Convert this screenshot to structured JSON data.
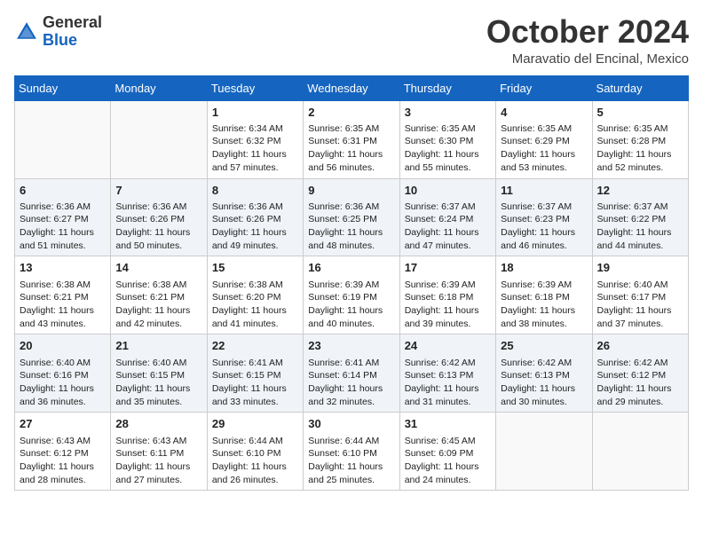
{
  "header": {
    "logo_general": "General",
    "logo_blue": "Blue",
    "month": "October 2024",
    "location": "Maravatio del Encinal, Mexico"
  },
  "weekdays": [
    "Sunday",
    "Monday",
    "Tuesday",
    "Wednesday",
    "Thursday",
    "Friday",
    "Saturday"
  ],
  "weeks": [
    [
      {
        "day": "",
        "info": ""
      },
      {
        "day": "",
        "info": ""
      },
      {
        "day": "1",
        "info": "Sunrise: 6:34 AM\nSunset: 6:32 PM\nDaylight: 11 hours and 57 minutes."
      },
      {
        "day": "2",
        "info": "Sunrise: 6:35 AM\nSunset: 6:31 PM\nDaylight: 11 hours and 56 minutes."
      },
      {
        "day": "3",
        "info": "Sunrise: 6:35 AM\nSunset: 6:30 PM\nDaylight: 11 hours and 55 minutes."
      },
      {
        "day": "4",
        "info": "Sunrise: 6:35 AM\nSunset: 6:29 PM\nDaylight: 11 hours and 53 minutes."
      },
      {
        "day": "5",
        "info": "Sunrise: 6:35 AM\nSunset: 6:28 PM\nDaylight: 11 hours and 52 minutes."
      }
    ],
    [
      {
        "day": "6",
        "info": "Sunrise: 6:36 AM\nSunset: 6:27 PM\nDaylight: 11 hours and 51 minutes."
      },
      {
        "day": "7",
        "info": "Sunrise: 6:36 AM\nSunset: 6:26 PM\nDaylight: 11 hours and 50 minutes."
      },
      {
        "day": "8",
        "info": "Sunrise: 6:36 AM\nSunset: 6:26 PM\nDaylight: 11 hours and 49 minutes."
      },
      {
        "day": "9",
        "info": "Sunrise: 6:36 AM\nSunset: 6:25 PM\nDaylight: 11 hours and 48 minutes."
      },
      {
        "day": "10",
        "info": "Sunrise: 6:37 AM\nSunset: 6:24 PM\nDaylight: 11 hours and 47 minutes."
      },
      {
        "day": "11",
        "info": "Sunrise: 6:37 AM\nSunset: 6:23 PM\nDaylight: 11 hours and 46 minutes."
      },
      {
        "day": "12",
        "info": "Sunrise: 6:37 AM\nSunset: 6:22 PM\nDaylight: 11 hours and 44 minutes."
      }
    ],
    [
      {
        "day": "13",
        "info": "Sunrise: 6:38 AM\nSunset: 6:21 PM\nDaylight: 11 hours and 43 minutes."
      },
      {
        "day": "14",
        "info": "Sunrise: 6:38 AM\nSunset: 6:21 PM\nDaylight: 11 hours and 42 minutes."
      },
      {
        "day": "15",
        "info": "Sunrise: 6:38 AM\nSunset: 6:20 PM\nDaylight: 11 hours and 41 minutes."
      },
      {
        "day": "16",
        "info": "Sunrise: 6:39 AM\nSunset: 6:19 PM\nDaylight: 11 hours and 40 minutes."
      },
      {
        "day": "17",
        "info": "Sunrise: 6:39 AM\nSunset: 6:18 PM\nDaylight: 11 hours and 39 minutes."
      },
      {
        "day": "18",
        "info": "Sunrise: 6:39 AM\nSunset: 6:18 PM\nDaylight: 11 hours and 38 minutes."
      },
      {
        "day": "19",
        "info": "Sunrise: 6:40 AM\nSunset: 6:17 PM\nDaylight: 11 hours and 37 minutes."
      }
    ],
    [
      {
        "day": "20",
        "info": "Sunrise: 6:40 AM\nSunset: 6:16 PM\nDaylight: 11 hours and 36 minutes."
      },
      {
        "day": "21",
        "info": "Sunrise: 6:40 AM\nSunset: 6:15 PM\nDaylight: 11 hours and 35 minutes."
      },
      {
        "day": "22",
        "info": "Sunrise: 6:41 AM\nSunset: 6:15 PM\nDaylight: 11 hours and 33 minutes."
      },
      {
        "day": "23",
        "info": "Sunrise: 6:41 AM\nSunset: 6:14 PM\nDaylight: 11 hours and 32 minutes."
      },
      {
        "day": "24",
        "info": "Sunrise: 6:42 AM\nSunset: 6:13 PM\nDaylight: 11 hours and 31 minutes."
      },
      {
        "day": "25",
        "info": "Sunrise: 6:42 AM\nSunset: 6:13 PM\nDaylight: 11 hours and 30 minutes."
      },
      {
        "day": "26",
        "info": "Sunrise: 6:42 AM\nSunset: 6:12 PM\nDaylight: 11 hours and 29 minutes."
      }
    ],
    [
      {
        "day": "27",
        "info": "Sunrise: 6:43 AM\nSunset: 6:12 PM\nDaylight: 11 hours and 28 minutes."
      },
      {
        "day": "28",
        "info": "Sunrise: 6:43 AM\nSunset: 6:11 PM\nDaylight: 11 hours and 27 minutes."
      },
      {
        "day": "29",
        "info": "Sunrise: 6:44 AM\nSunset: 6:10 PM\nDaylight: 11 hours and 26 minutes."
      },
      {
        "day": "30",
        "info": "Sunrise: 6:44 AM\nSunset: 6:10 PM\nDaylight: 11 hours and 25 minutes."
      },
      {
        "day": "31",
        "info": "Sunrise: 6:45 AM\nSunset: 6:09 PM\nDaylight: 11 hours and 24 minutes."
      },
      {
        "day": "",
        "info": ""
      },
      {
        "day": "",
        "info": ""
      }
    ]
  ]
}
